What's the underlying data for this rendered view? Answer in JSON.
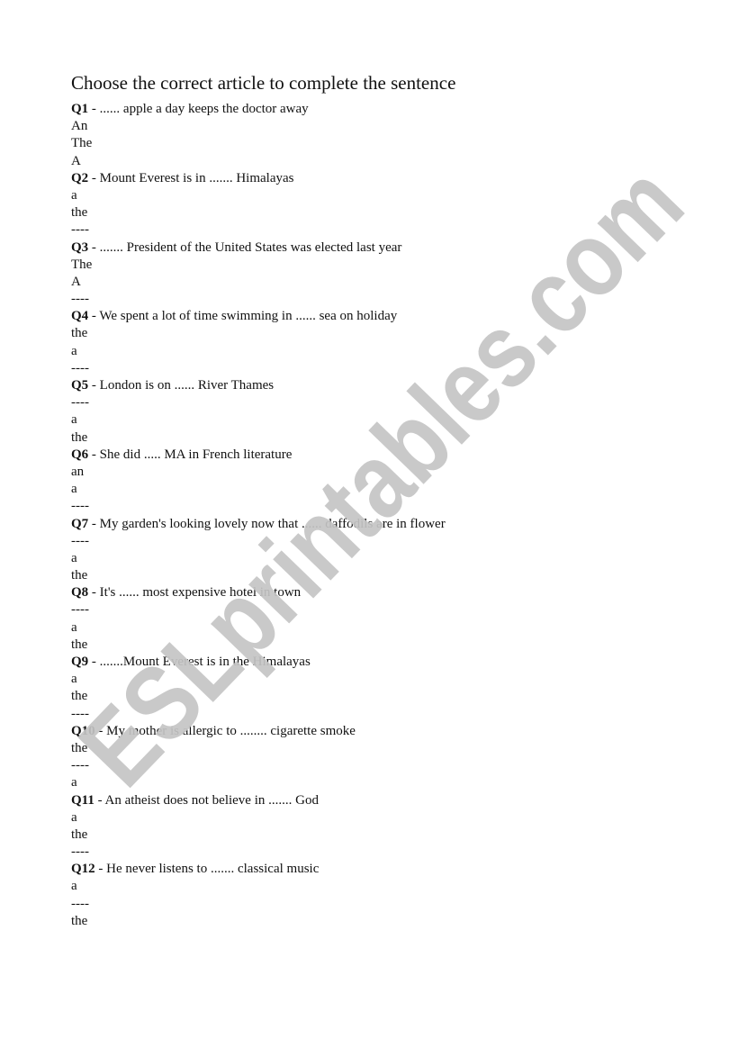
{
  "title": "Choose the correct article to complete the sentence",
  "watermark": {
    "text": "ESLprintables.com",
    "color": "#c4c4c4"
  },
  "questions": [
    {
      "label": "Q1",
      "text": " - ...... apple a day keeps the doctor away",
      "options": [
        "An",
        "The",
        "A"
      ]
    },
    {
      "label": "Q2",
      "text": " - Mount Everest is in ....... Himalayas",
      "options": [
        "a",
        "the",
        "----"
      ]
    },
    {
      "label": "Q3",
      "text": " - ....... President of the United States was elected last year",
      "options": [
        "The",
        "A",
        "----"
      ]
    },
    {
      "label": "Q4",
      "text": " - We spent a lot of time swimming in ...... sea on holiday",
      "options": [
        "the",
        "a",
        "----"
      ]
    },
    {
      "label": "Q5",
      "text": " - London is on ...... River Thames",
      "options": [
        "----",
        "a",
        "the"
      ]
    },
    {
      "label": "Q6",
      "text": " - She did ..... MA in French literature",
      "options": [
        "an",
        "a",
        "----"
      ]
    },
    {
      "label": "Q7",
      "text": " - My garden's looking lovely now that ...... daffodils are in flower",
      "options": [
        "----",
        "a",
        "the"
      ]
    },
    {
      "label": "Q8",
      "text": " - It's ...... most expensive hotel in town",
      "options": [
        "----",
        "a",
        "the"
      ]
    },
    {
      "label": "Q9",
      "text": " - .......Mount Everest is in the Himalayas",
      "options": [
        "a",
        "the",
        "----"
      ]
    },
    {
      "label": "Q10",
      "text": " - My mother is allergic to ........ cigarette smoke",
      "options": [
        "the",
        "----",
        "a"
      ]
    },
    {
      "label": "Q11",
      "text": " - An atheist does not believe in ....... God",
      "options": [
        "a",
        "the",
        "----"
      ]
    },
    {
      "label": "Q12",
      "text": " - He never listens to ....... classical music",
      "options": [
        "a",
        "----",
        "the"
      ]
    }
  ]
}
